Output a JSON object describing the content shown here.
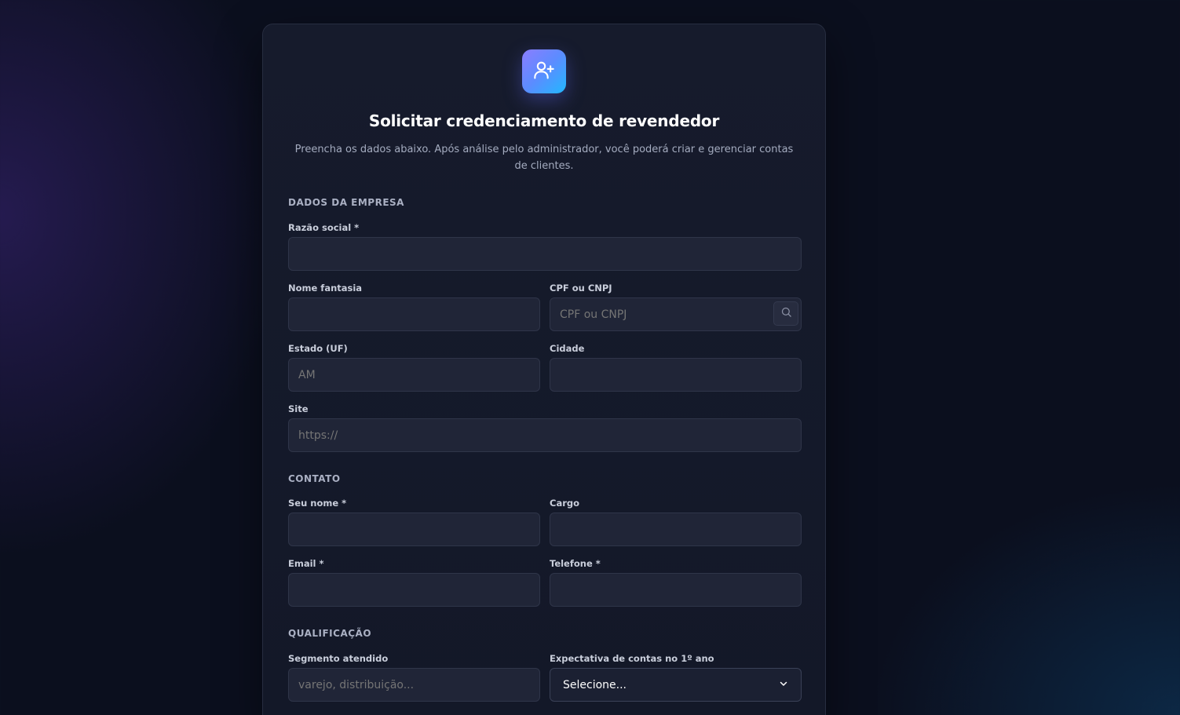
{
  "header": {
    "logo_icon": "user-plus-icon",
    "title": "Solicitar credenciamento de revendedor",
    "subtitle": "Preencha os dados abaixo. Após análise pelo administrador, você poderá criar e gerenciar contas de clientes."
  },
  "sections": {
    "empresa": "DADOS DA EMPRESA",
    "contato": "CONTATO",
    "qualificacao": "QUALIFICAÇÃO"
  },
  "fields": {
    "razao_social": {
      "label": "Razão social *",
      "value": "",
      "placeholder": ""
    },
    "nome_fantasia": {
      "label": "Nome fantasia",
      "value": "",
      "placeholder": ""
    },
    "cpf_cnpj": {
      "label": "CPF ou CNPJ",
      "value": "",
      "placeholder": "CPF ou CNPJ",
      "button_icon": "search-icon"
    },
    "estado": {
      "label": "Estado (UF)",
      "value": "",
      "placeholder": "AM"
    },
    "cidade": {
      "label": "Cidade",
      "value": "",
      "placeholder": ""
    },
    "site": {
      "label": "Site",
      "value": "",
      "placeholder": "https://"
    },
    "seu_nome": {
      "label": "Seu nome *",
      "value": "",
      "placeholder": ""
    },
    "cargo": {
      "label": "Cargo",
      "value": "",
      "placeholder": ""
    },
    "email": {
      "label": "Email *",
      "value": "",
      "placeholder": ""
    },
    "telefone": {
      "label": "Telefone *",
      "value": "",
      "placeholder": ""
    },
    "segmento": {
      "label": "Segmento atendido",
      "value": "",
      "placeholder": "varejo, distribuição..."
    },
    "expectativa": {
      "label": "Expectativa de contas no 1º ano",
      "selected": "Selecione..."
    }
  },
  "colors": {
    "background": "#0b0f1e",
    "card": "#151a2b",
    "input": "#202537",
    "accent_start": "#8b7dff",
    "accent_end": "#22b8ff"
  }
}
